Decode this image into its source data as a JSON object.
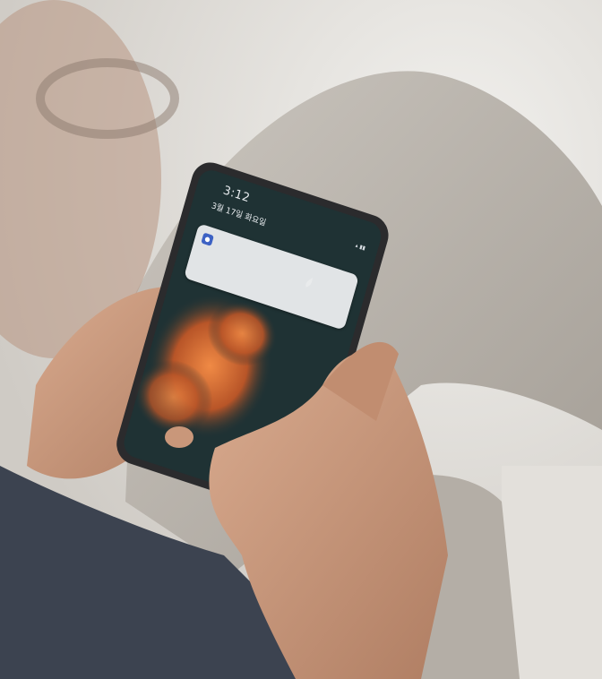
{
  "scene": {
    "description_colors": {
      "background": "#d9d6d1",
      "trousers": "#b9b3ab",
      "shirt": "#3c4350",
      "skin": "#c9977a",
      "phone_frame": "#2b2b2d",
      "screen_sky": "#1f3234",
      "cloud_glow": "#e0783a"
    }
  },
  "phone": {
    "lock_screen": {
      "time": "3:12",
      "date": "3월 17일 화요일"
    },
    "notification": {
      "app_icon": "app-logo-icon",
      "app_name": "",
      "line1": "",
      "line2": ""
    }
  }
}
